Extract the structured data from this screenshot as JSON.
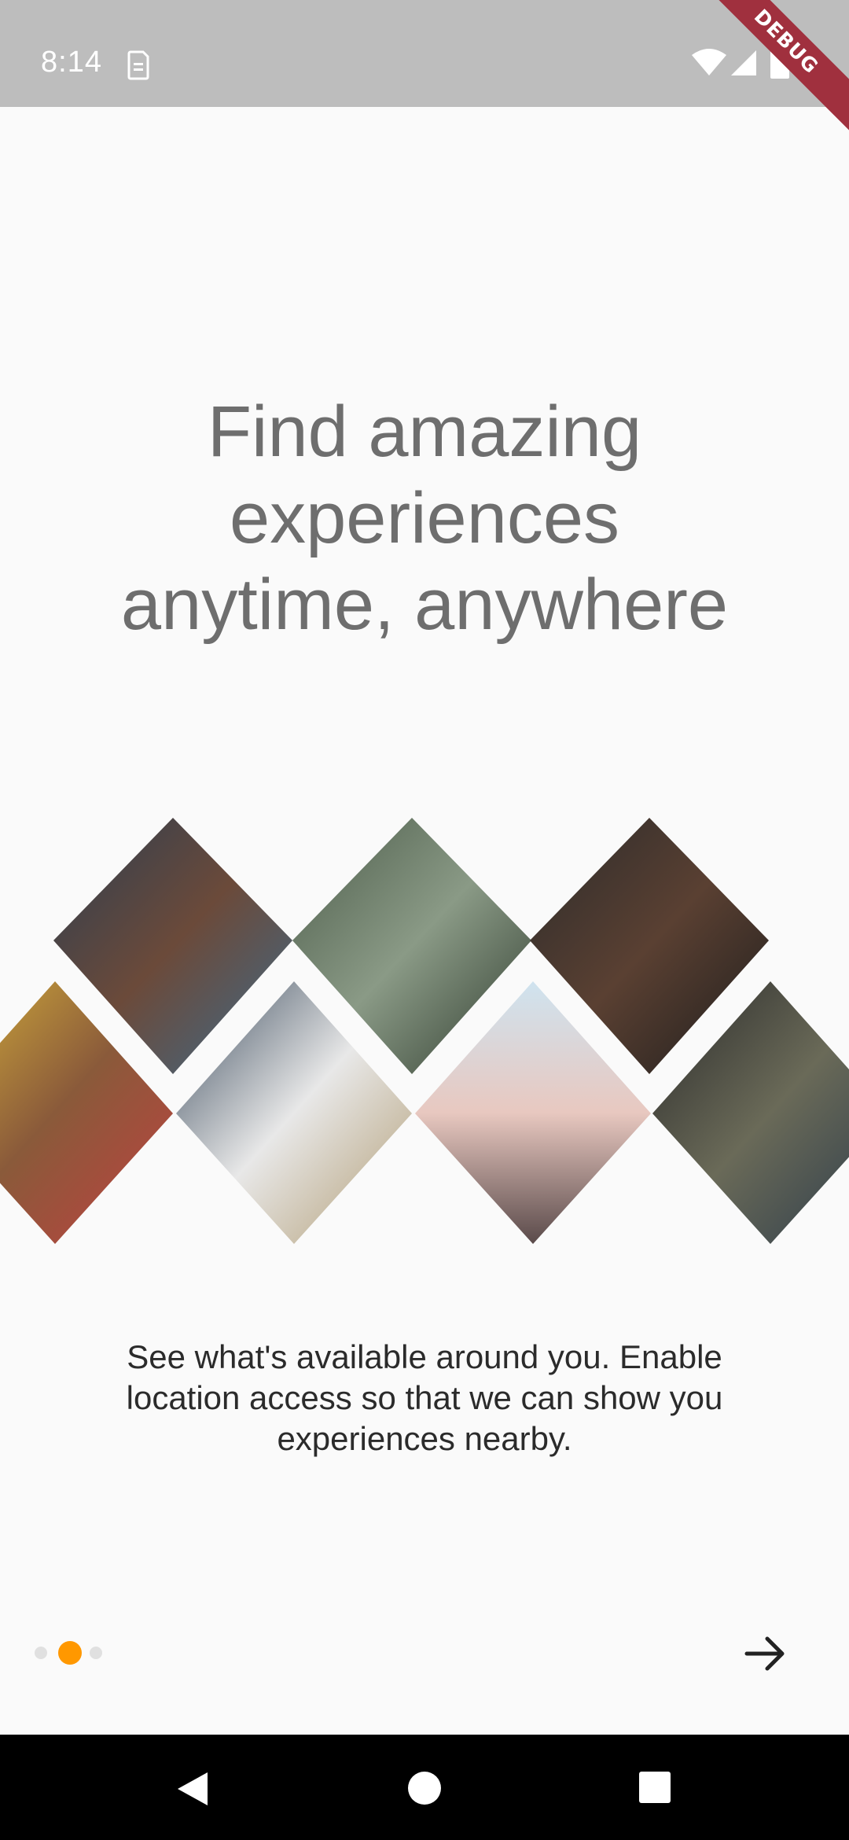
{
  "status_bar": {
    "time": "8:14",
    "debug_label": "DEBUG",
    "icons": [
      "sim-card-icon",
      "wifi-icon",
      "cellular-signal-icon",
      "battery-icon"
    ]
  },
  "onboarding": {
    "headline": "Find amazing experiences anytime, anywhere",
    "description": "See what's available around you. Enable location access so that we can show you experiences nearby.",
    "collage_photos": [
      "woman-with-drink-photo",
      "zipline-rider-photo",
      "smiling-couple-photo",
      "market-vendors-photo",
      "chef-at-table-photo",
      "meditating-man-beach-photo",
      "motorcyclist-photo"
    ],
    "page_indicator": {
      "total": 3,
      "active_index": 1,
      "active_color": "#ff9800",
      "inactive_color": "#e0e0e0"
    },
    "next_icon": "arrow-right-icon"
  },
  "nav_bar": {
    "icons": [
      "back-icon",
      "home-icon",
      "recent-apps-icon"
    ]
  }
}
